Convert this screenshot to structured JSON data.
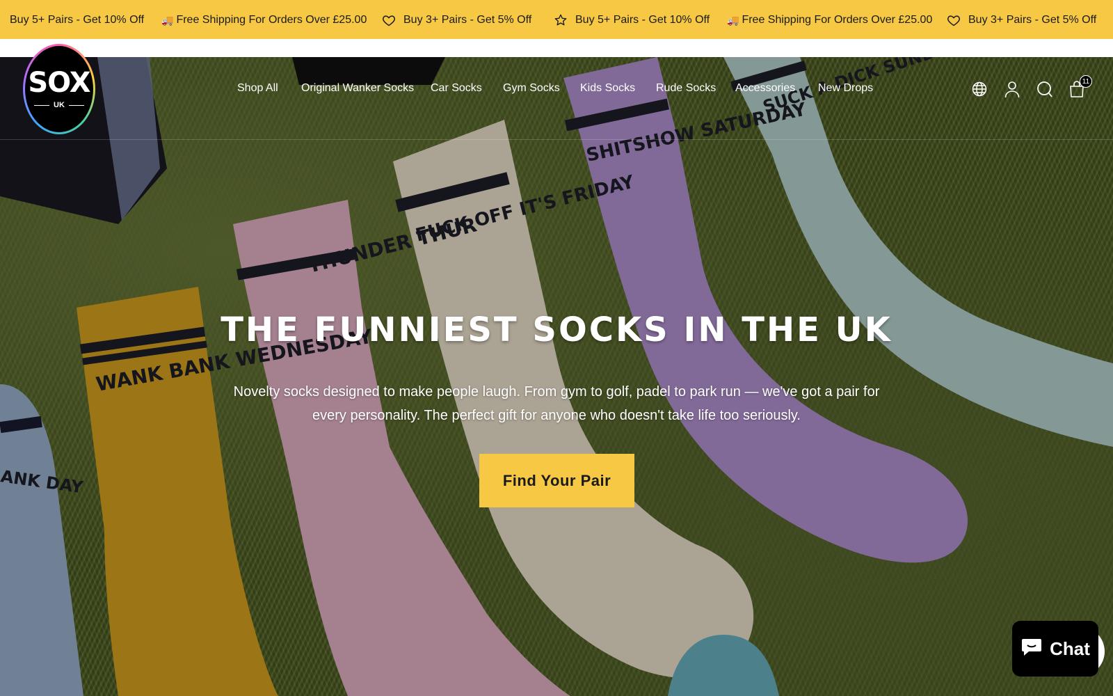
{
  "announcement_bar": {
    "items": [
      {
        "icon": "none",
        "text": "Buy 5+ Pairs - Get 10% Off"
      },
      {
        "icon": "truck-emoji",
        "text": "Free Shipping For Orders Over £25.00"
      },
      {
        "icon": "heart-icon",
        "text": "Buy 3+ Pairs - Get 5% Off"
      },
      {
        "icon": "star-icon",
        "text": "Buy 5+ Pairs - Get 10% Off"
      },
      {
        "icon": "truck-emoji",
        "text": "Free Shipping For Orders Over £25.00"
      },
      {
        "icon": "heart-icon",
        "text": "Buy 3+ Pairs - Get 5% Off"
      }
    ],
    "truck_glyph": "🚚",
    "background": "#f6c844"
  },
  "header": {
    "logo": {
      "main": "SOX",
      "sub": "UK"
    },
    "nav": [
      "Shop All",
      "Original Wanker Socks",
      "Car Socks",
      "Gym Socks",
      "Kids Socks",
      "Rude Socks",
      "Accessories",
      "New Drops"
    ],
    "icons": [
      "globe-icon",
      "account-icon",
      "search-icon",
      "cart-icon"
    ],
    "cart_count": "11"
  },
  "hero": {
    "title": "The Funniest Socks in the UK",
    "subtitle": "Novelty socks designed to make people laugh. From gym to golf, padel to park run — we've got a pair for every personality. The perfect gift for anyone who doesn't take life too seriously.",
    "cta_label": "Find Your Pair",
    "sock_texts": {
      "wank": "WANK BANK WEDNESDAY",
      "thunder": "THUNDER THUR",
      "friday": "FUCK OFF IT'S FRIDAY",
      "saturday": "SHITSHOW SATURDAY",
      "sunday": "SUCK A DICK SUNDAY",
      "blue_partial": "ANK DAY"
    },
    "accent_color": "#f6c844"
  },
  "chat_widget": {
    "label": "Chat"
  }
}
